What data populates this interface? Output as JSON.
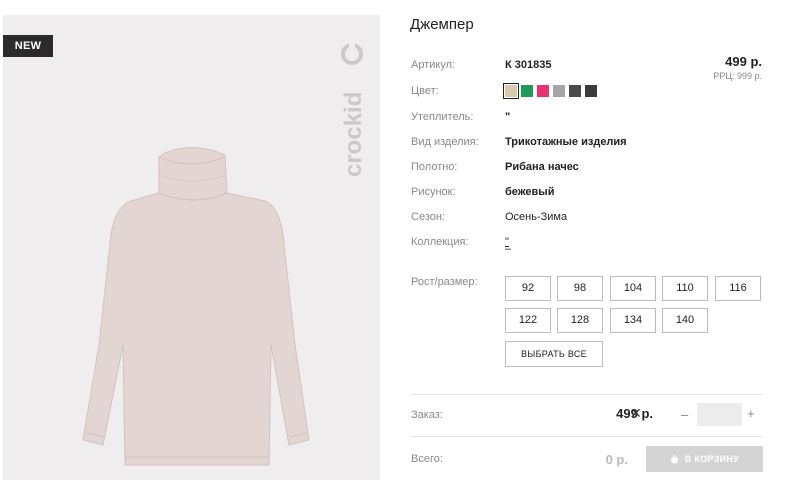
{
  "product": {
    "title": "Джемпер",
    "badge": "NEW",
    "brand_logo_text": "crockid",
    "price": "499 р.",
    "rrp": "РРЦ: 999 р."
  },
  "specs": {
    "article_label": "Артикул:",
    "article_value": "К 301835",
    "color_label": "Цвет:",
    "insulation_label": "Утеплитель:",
    "insulation_value": "\"",
    "type_label": "Вид изделия:",
    "type_value": "Трикотажные изделия",
    "fabric_label": "Полотно:",
    "fabric_value": "Рибана начес",
    "pattern_label": "Рисунок:",
    "pattern_value": "бежевый",
    "season_label": "Сезон:",
    "season_value": "Осень-Зима",
    "collection_label": "Коллекция:",
    "collection_value": "\"",
    "collection_value2": "–"
  },
  "swatches": [
    {
      "color": "#d9c9ad",
      "selected": true
    },
    {
      "color": "#1f9a5a",
      "selected": false
    },
    {
      "color": "#e8336e",
      "selected": false
    },
    {
      "color": "#a5a5a5",
      "selected": false
    },
    {
      "color": "#4a4a4a",
      "selected": false
    },
    {
      "color": "#3a3a3a",
      "selected": false
    }
  ],
  "sizes": {
    "label": "Рост/размер:",
    "options": [
      "92",
      "98",
      "104",
      "110",
      "116",
      "122",
      "128",
      "134",
      "140"
    ],
    "select_all_label": "ВЫБРАТЬ ВСЕ"
  },
  "order": {
    "label": "Заказ:",
    "total": "499 р.",
    "clear_icon": "close-icon",
    "minus": "–",
    "plus": "+",
    "quantity": ""
  },
  "summary": {
    "label": "Всего:",
    "total": "0 р.",
    "cart_button_label": "В КОРЗИНУ",
    "cart_icon": "cart-icon"
  },
  "colors": {
    "photo_bg": "#efeded",
    "garment": "#e3d5d2",
    "badge_bg": "#2b2b2b",
    "cart_button_bg": "#d4d4d4"
  }
}
